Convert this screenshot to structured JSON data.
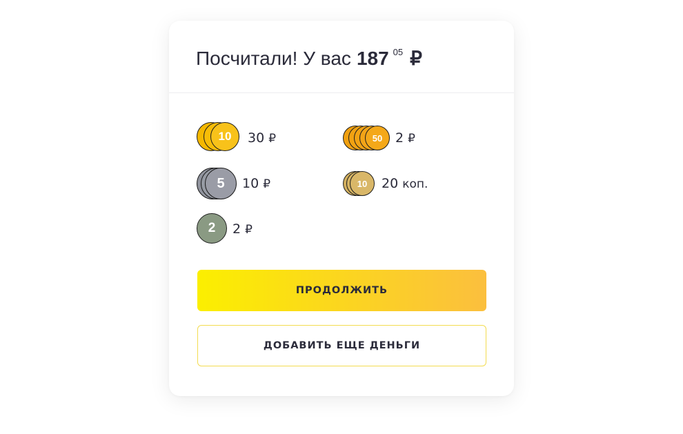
{
  "header": {
    "title": "Посчитали! У вас",
    "amount_rubles": "187",
    "amount_kopecks": "05",
    "currency": "₽"
  },
  "coins": [
    {
      "denomination": "10",
      "amount": "30",
      "unit": "₽",
      "color": "#f8c21a"
    },
    {
      "denomination": "50",
      "amount": "2",
      "unit": "₽",
      "color": "#f2a417"
    },
    {
      "denomination": "5",
      "amount": "10",
      "unit": "₽",
      "color": "#9a9ca6"
    },
    {
      "denomination": "10",
      "amount": "20",
      "unit": "коп.",
      "color": "#d9b768"
    },
    {
      "denomination": "2",
      "amount": "2",
      "unit": "₽",
      "color": "#8a9a83"
    }
  ],
  "actions": {
    "continue_label": "ПРОДОЛЖИТЬ",
    "add_money_label": "ДОБАВИТЬ ЕЩЕ ДЕНЬГИ"
  }
}
